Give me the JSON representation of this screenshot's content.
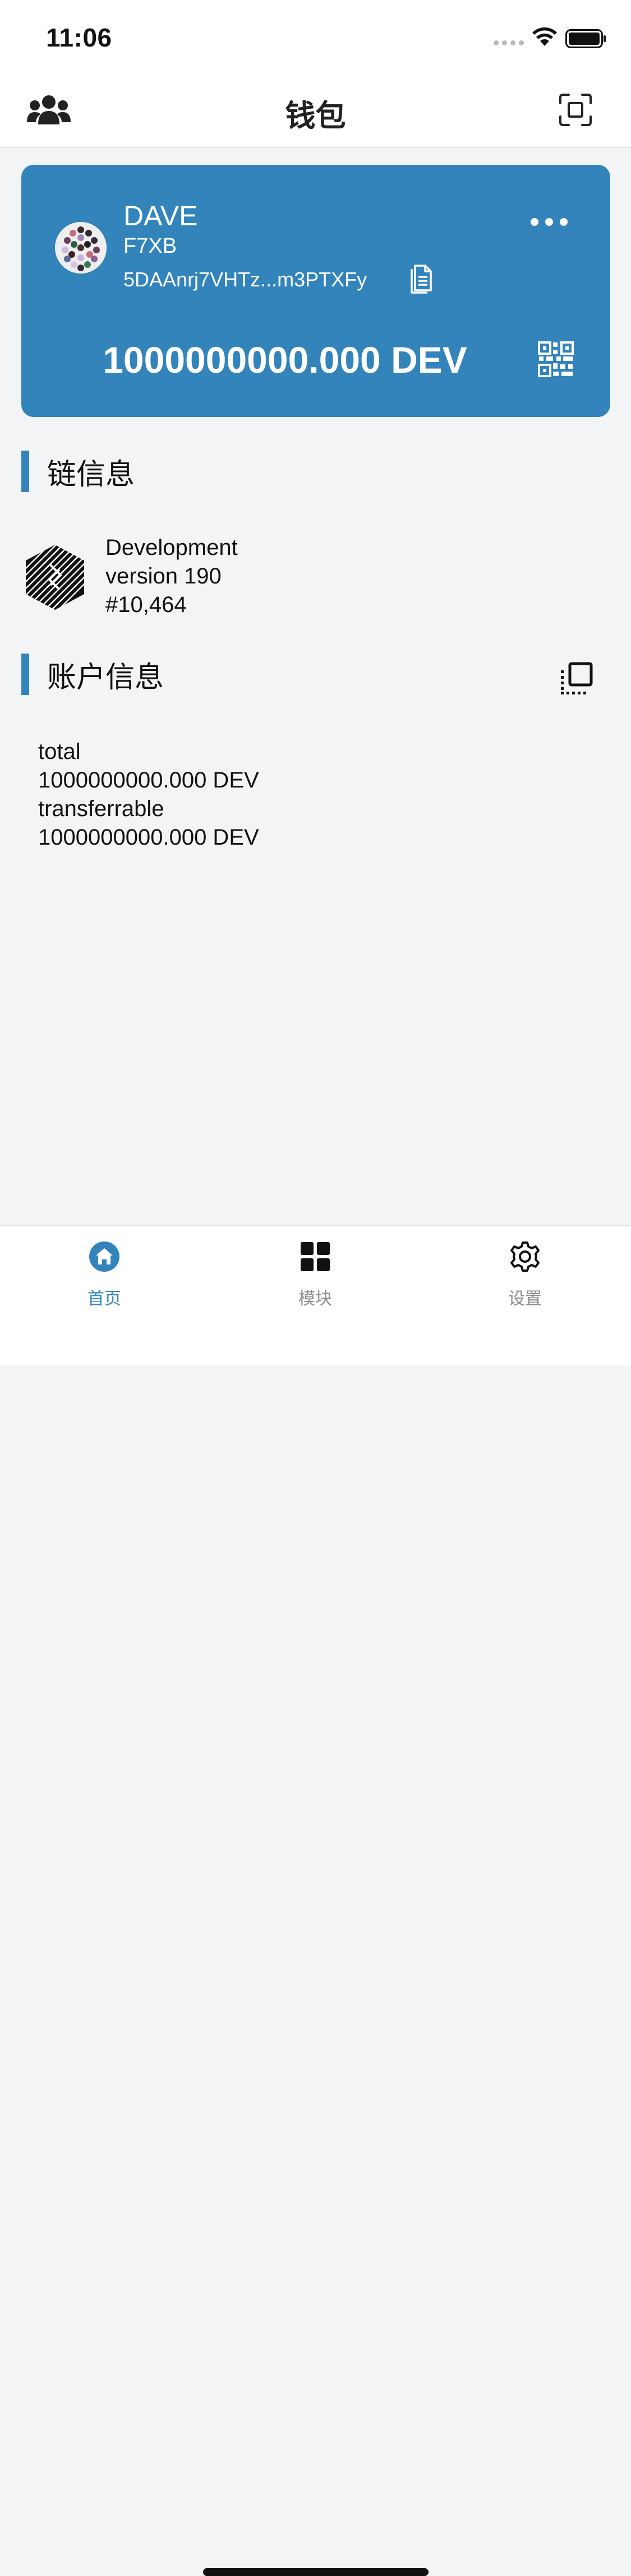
{
  "status_bar": {
    "time": "11:06"
  },
  "header": {
    "title": "钱包",
    "left_icon": "contacts-icon",
    "right_icon": "scan-icon"
  },
  "account_card": {
    "name": "DAVE",
    "short_id": "F7XB",
    "address": "5DAAnrj7VHTz...m3PTXFy",
    "balance": "1000000000.000 DEV",
    "background_color": "#3284bb"
  },
  "chain_section": {
    "title": "链信息",
    "chain_name": "Development",
    "version": "version 190",
    "block": "#10,464"
  },
  "account_section": {
    "title": "账户信息",
    "balances": [
      {
        "label": "total",
        "value": "1000000000.000 DEV"
      },
      {
        "label": "transferrable",
        "value": "1000000000.000 DEV"
      }
    ]
  },
  "tab_bar": {
    "tabs": [
      {
        "label": "首页",
        "icon": "home-icon",
        "active": true
      },
      {
        "label": "模块",
        "icon": "grid-icon",
        "active": false
      },
      {
        "label": "设置",
        "icon": "gear-icon",
        "active": false
      }
    ],
    "active_color": "#3284bb",
    "inactive_color": "#8d8d8d"
  }
}
